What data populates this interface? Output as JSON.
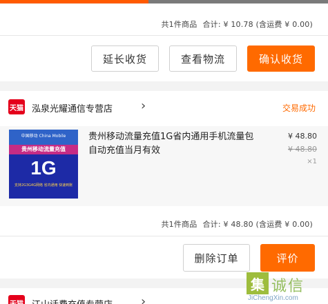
{
  "order1": {
    "summary_count": "共1件商品",
    "summary_total": "合计: ¥ 10.78 (含运费 ¥ 0.00)",
    "buttons": [
      "延长收货",
      "查看物流",
      "确认收货"
    ]
  },
  "order2": {
    "store_logo": "天猫",
    "store_name": "泓泉光耀通信专营店",
    "status": "交易成功",
    "item": {
      "title": "贵州移动流量充值1G省内通用手机流量包自动充值当月有效",
      "price": "¥ 48.80",
      "original_price": "¥ 48.80",
      "quantity": "×1",
      "thumb_brand": "中国移动 China Mobile",
      "thumb_band": "贵州移动流量充值",
      "thumb_big": "1G",
      "thumb_fine": "支持2G3G4G网络 省内通用 快速到账"
    },
    "summary_count": "共1件商品",
    "summary_total": "合计: ¥ 48.80 (含运费 ¥ 0.00)",
    "buttons": [
      "删除订单",
      "评价"
    ]
  },
  "order3": {
    "store_logo": "天猫",
    "store_name": "江山话费充值专营店"
  },
  "watermark": {
    "glyph": "集",
    "text": "诚信",
    "url": "JiChengXin.com"
  }
}
